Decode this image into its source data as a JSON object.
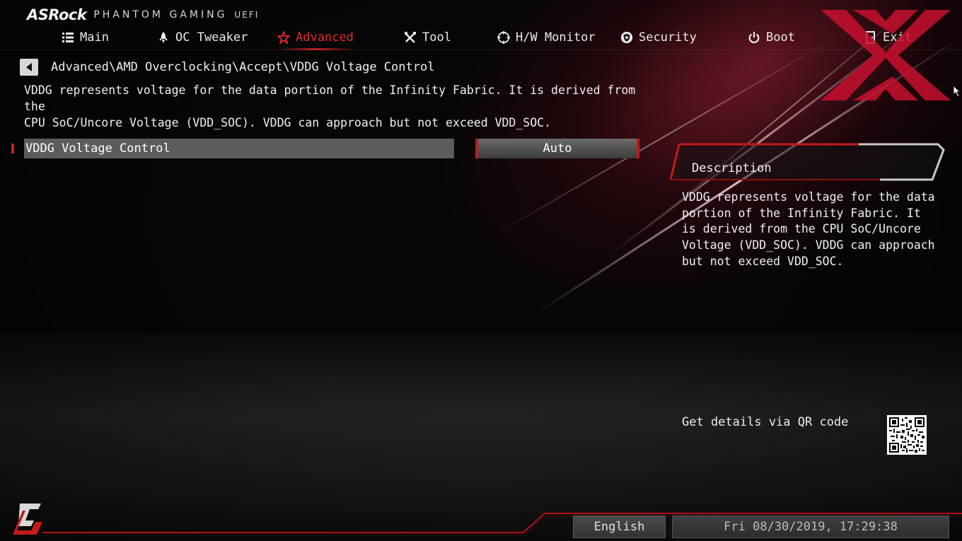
{
  "brand": {
    "logo": "ASRock",
    "title": "PHANTOM GAMING",
    "suffix": "UEFI"
  },
  "nav": {
    "items": [
      {
        "label": "Main",
        "icon": "list-icon"
      },
      {
        "label": "OC Tweaker",
        "icon": "rocket-icon"
      },
      {
        "label": "Advanced",
        "icon": "star-icon",
        "active": true
      },
      {
        "label": "Tool",
        "icon": "tools-icon"
      },
      {
        "label": "H/W Monitor",
        "icon": "crosshair-icon"
      },
      {
        "label": "Security",
        "icon": "shield-icon"
      },
      {
        "label": "Boot",
        "icon": "power-icon"
      },
      {
        "label": "Exit",
        "icon": "exit-door-icon"
      }
    ]
  },
  "breadcrumb": {
    "path": "Advanced\\AMD Overclocking\\Accept\\VDDG Voltage Control"
  },
  "page": {
    "description": "VDDG represents voltage for the data portion of the Infinity Fabric. It is derived from the\nCPU SoC/Uncore Voltage (VDD_SOC). VDDG can approach but not exceed VDD_SOC."
  },
  "option": {
    "label": "VDDG Voltage Control",
    "value": "Auto"
  },
  "description_panel": {
    "title": "Description",
    "text": "VDDG represents voltage for the data\nportion of the Infinity Fabric. It\nis derived from the CPU SoC/Uncore\nVoltage (VDD_SOC). VDDG can approach\nbut not exceed VDD_SOC."
  },
  "qr": {
    "label": "Get details via QR code"
  },
  "footer": {
    "language": "English",
    "datetime": "Fri 08/30/2019, 17:29:38"
  },
  "colors": {
    "accent": "#e22a2a",
    "background": "#060606",
    "highlight_bar": "#5c5c5c"
  }
}
